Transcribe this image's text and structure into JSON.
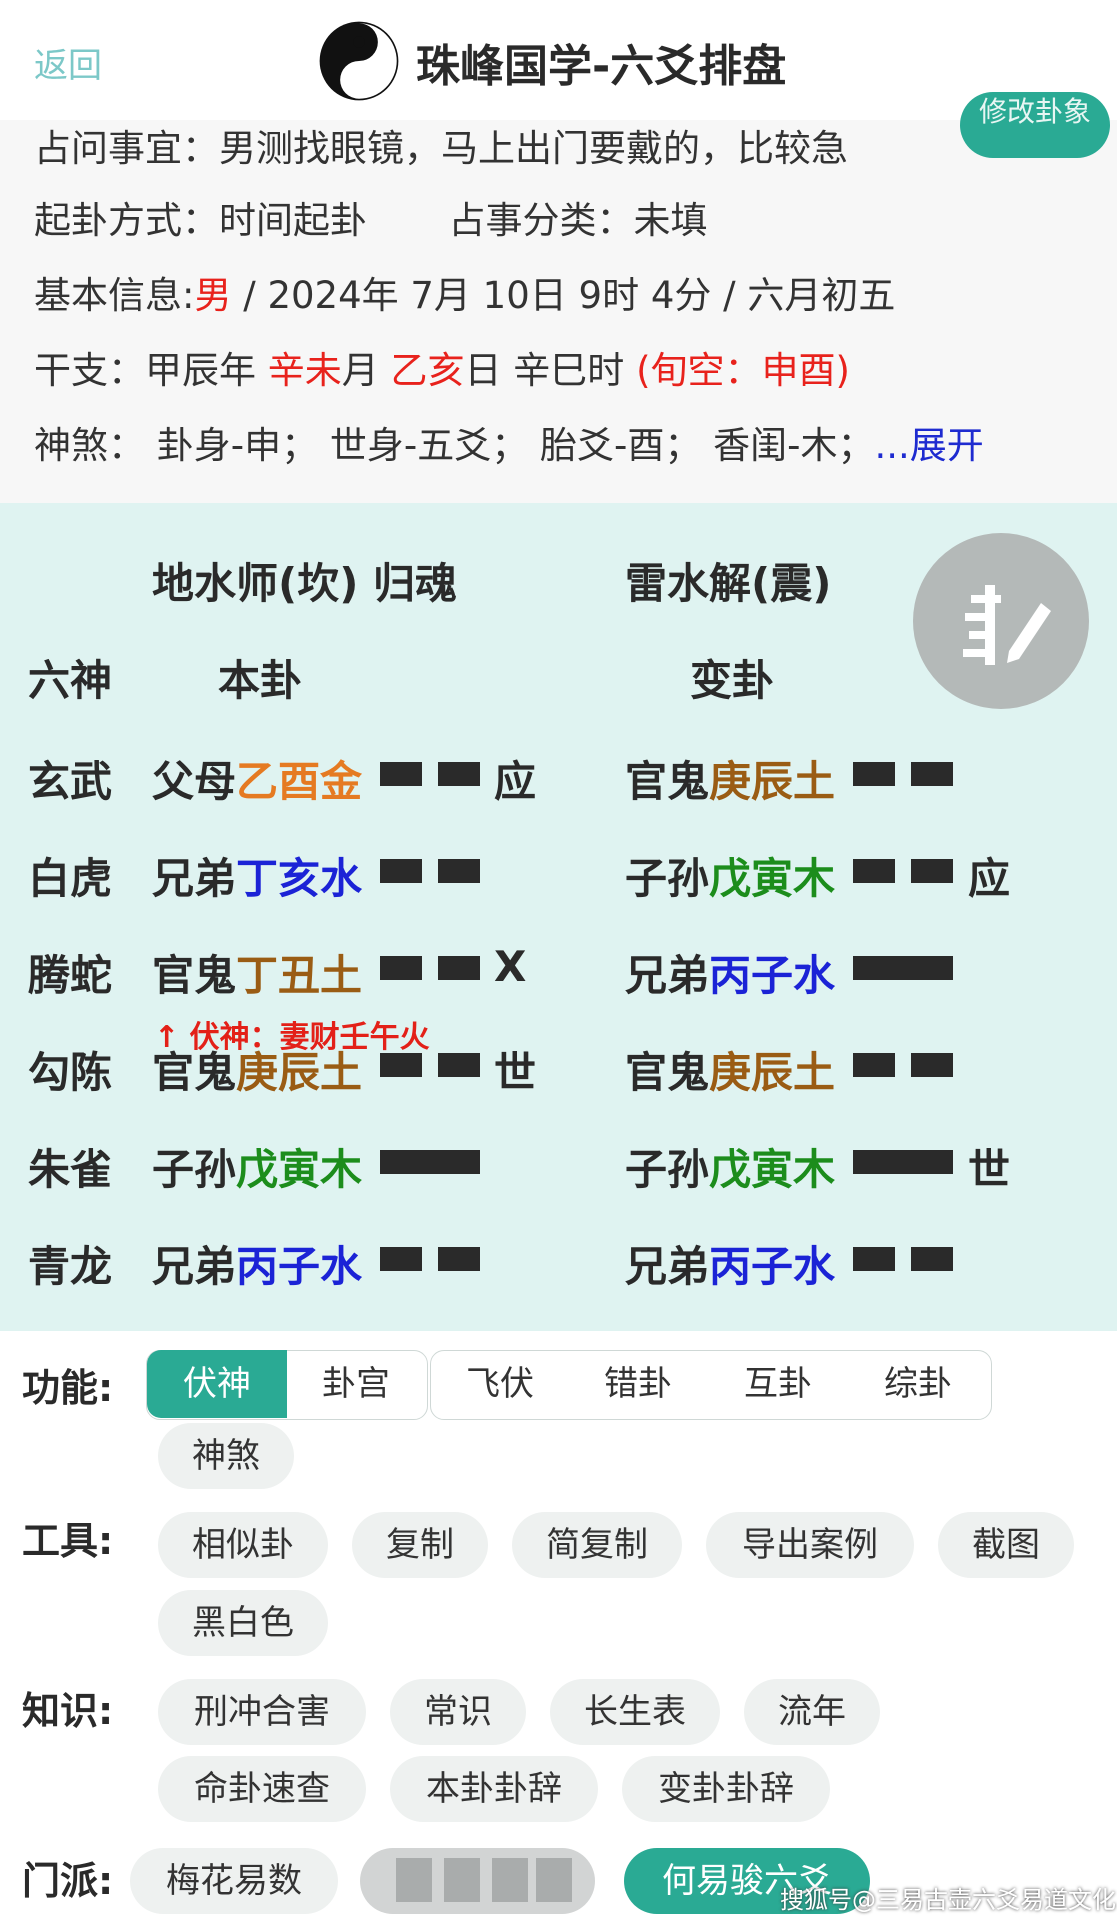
{
  "header": {
    "back_label": "返回",
    "title": "珠峰国学-六爻排盘",
    "edit_label": "修改卦象"
  },
  "info": {
    "question_label": "占问事宜：",
    "question_value": "男测找眼镜，马上出门要戴的，比较急",
    "method_label": "起卦方式：",
    "method_value": "时间起卦",
    "category_label": "占事分类：",
    "category_value": "未填",
    "basic_label": "基本信息:",
    "gender": "男",
    "basic_rest": " / 2024年 7月 10日 9时 4分 / 六月初五",
    "ganzhi_label": "干支：",
    "year_gz": "甲辰年 ",
    "month_gz_red": "辛未",
    "month_suffix": "月 ",
    "day_gz_red": "乙亥",
    "day_suffix": "日 ",
    "hour_gz": "辛巳时 ",
    "xunkong": "(旬空：申酉)",
    "shensha_label": "神煞：",
    "shensha_value": " 卦身-申； 世身-五爻； 胎爻-酉； 香闺-木；",
    "expand_label": "...展开"
  },
  "hexagram": {
    "main_title": "地水师(坎) 归魂",
    "changed_title": "雷水解(震)",
    "col_liushen": "六神",
    "col_main": "本卦",
    "col_changed": "变卦",
    "fushen_note": "↑ 伏神：妻财壬午火",
    "rows": [
      {
        "god": "玄武",
        "m_kin": "父母",
        "m_gz": "乙酉金",
        "m_color": "c-orange",
        "m_yin": true,
        "m_mark": "应",
        "c_kin": "官鬼",
        "c_gz": "庚辰土",
        "c_color": "c-brown",
        "c_yin": true,
        "c_mark": ""
      },
      {
        "god": "白虎",
        "m_kin": "兄弟",
        "m_gz": "丁亥水",
        "m_color": "c-blue",
        "m_yin": true,
        "m_mark": "",
        "c_kin": "子孙",
        "c_gz": "戊寅木",
        "c_color": "c-green",
        "c_yin": true,
        "c_mark": "应"
      },
      {
        "god": "腾蛇",
        "m_kin": "官鬼",
        "m_gz": "丁丑土",
        "m_color": "c-brown",
        "m_yin": true,
        "m_mark": "X",
        "c_kin": "兄弟",
        "c_gz": "丙子水",
        "c_color": "c-blue",
        "c_yin": false,
        "c_mark": ""
      },
      {
        "god": "勾陈",
        "m_kin": "官鬼",
        "m_gz": "庚辰土",
        "m_color": "c-brown",
        "m_yin": true,
        "m_mark": "世",
        "c_kin": "官鬼",
        "c_gz": "庚辰土",
        "c_color": "c-brown",
        "c_yin": true,
        "c_mark": ""
      },
      {
        "god": "朱雀",
        "m_kin": "子孙",
        "m_gz": "戊寅木",
        "m_color": "c-green",
        "m_yin": false,
        "m_mark": "",
        "c_kin": "子孙",
        "c_gz": "戊寅木",
        "c_color": "c-green",
        "c_yin": false,
        "c_mark": "世"
      },
      {
        "god": "青龙",
        "m_kin": "兄弟",
        "m_gz": "丙子水",
        "m_color": "c-blue",
        "m_yin": true,
        "m_mark": "",
        "c_kin": "兄弟",
        "c_gz": "丙子水",
        "c_color": "c-blue",
        "c_yin": true,
        "c_mark": ""
      }
    ]
  },
  "functions": {
    "label": "功能:",
    "tabs": [
      "伏神",
      "卦宫",
      "飞伏",
      "错卦",
      "互卦",
      "综卦"
    ],
    "shensha": "神煞"
  },
  "tools": {
    "label": "工具:",
    "items": [
      "相似卦",
      "复制",
      "简复制",
      "导出案例",
      "截图",
      "黑白色"
    ]
  },
  "knowledge": {
    "label": "知识:",
    "items": [
      "刑冲合害",
      "常识",
      "长生表",
      "流年",
      "命卦速查",
      "本卦卦辞",
      "变卦卦辞"
    ]
  },
  "school": {
    "label": "门派:",
    "items": [
      "梅花易数",
      "何易骏六爻"
    ]
  },
  "watermark": "搜狐号@三易古壶六爻易道文化",
  "colors": {
    "accent": "#2aaa94",
    "panel_bg": "#dff3f1",
    "red": "#e8221c",
    "blue": "#1b23d6",
    "green": "#1c8d1c",
    "brown": "#9a5c14",
    "orange": "#e57a22"
  }
}
